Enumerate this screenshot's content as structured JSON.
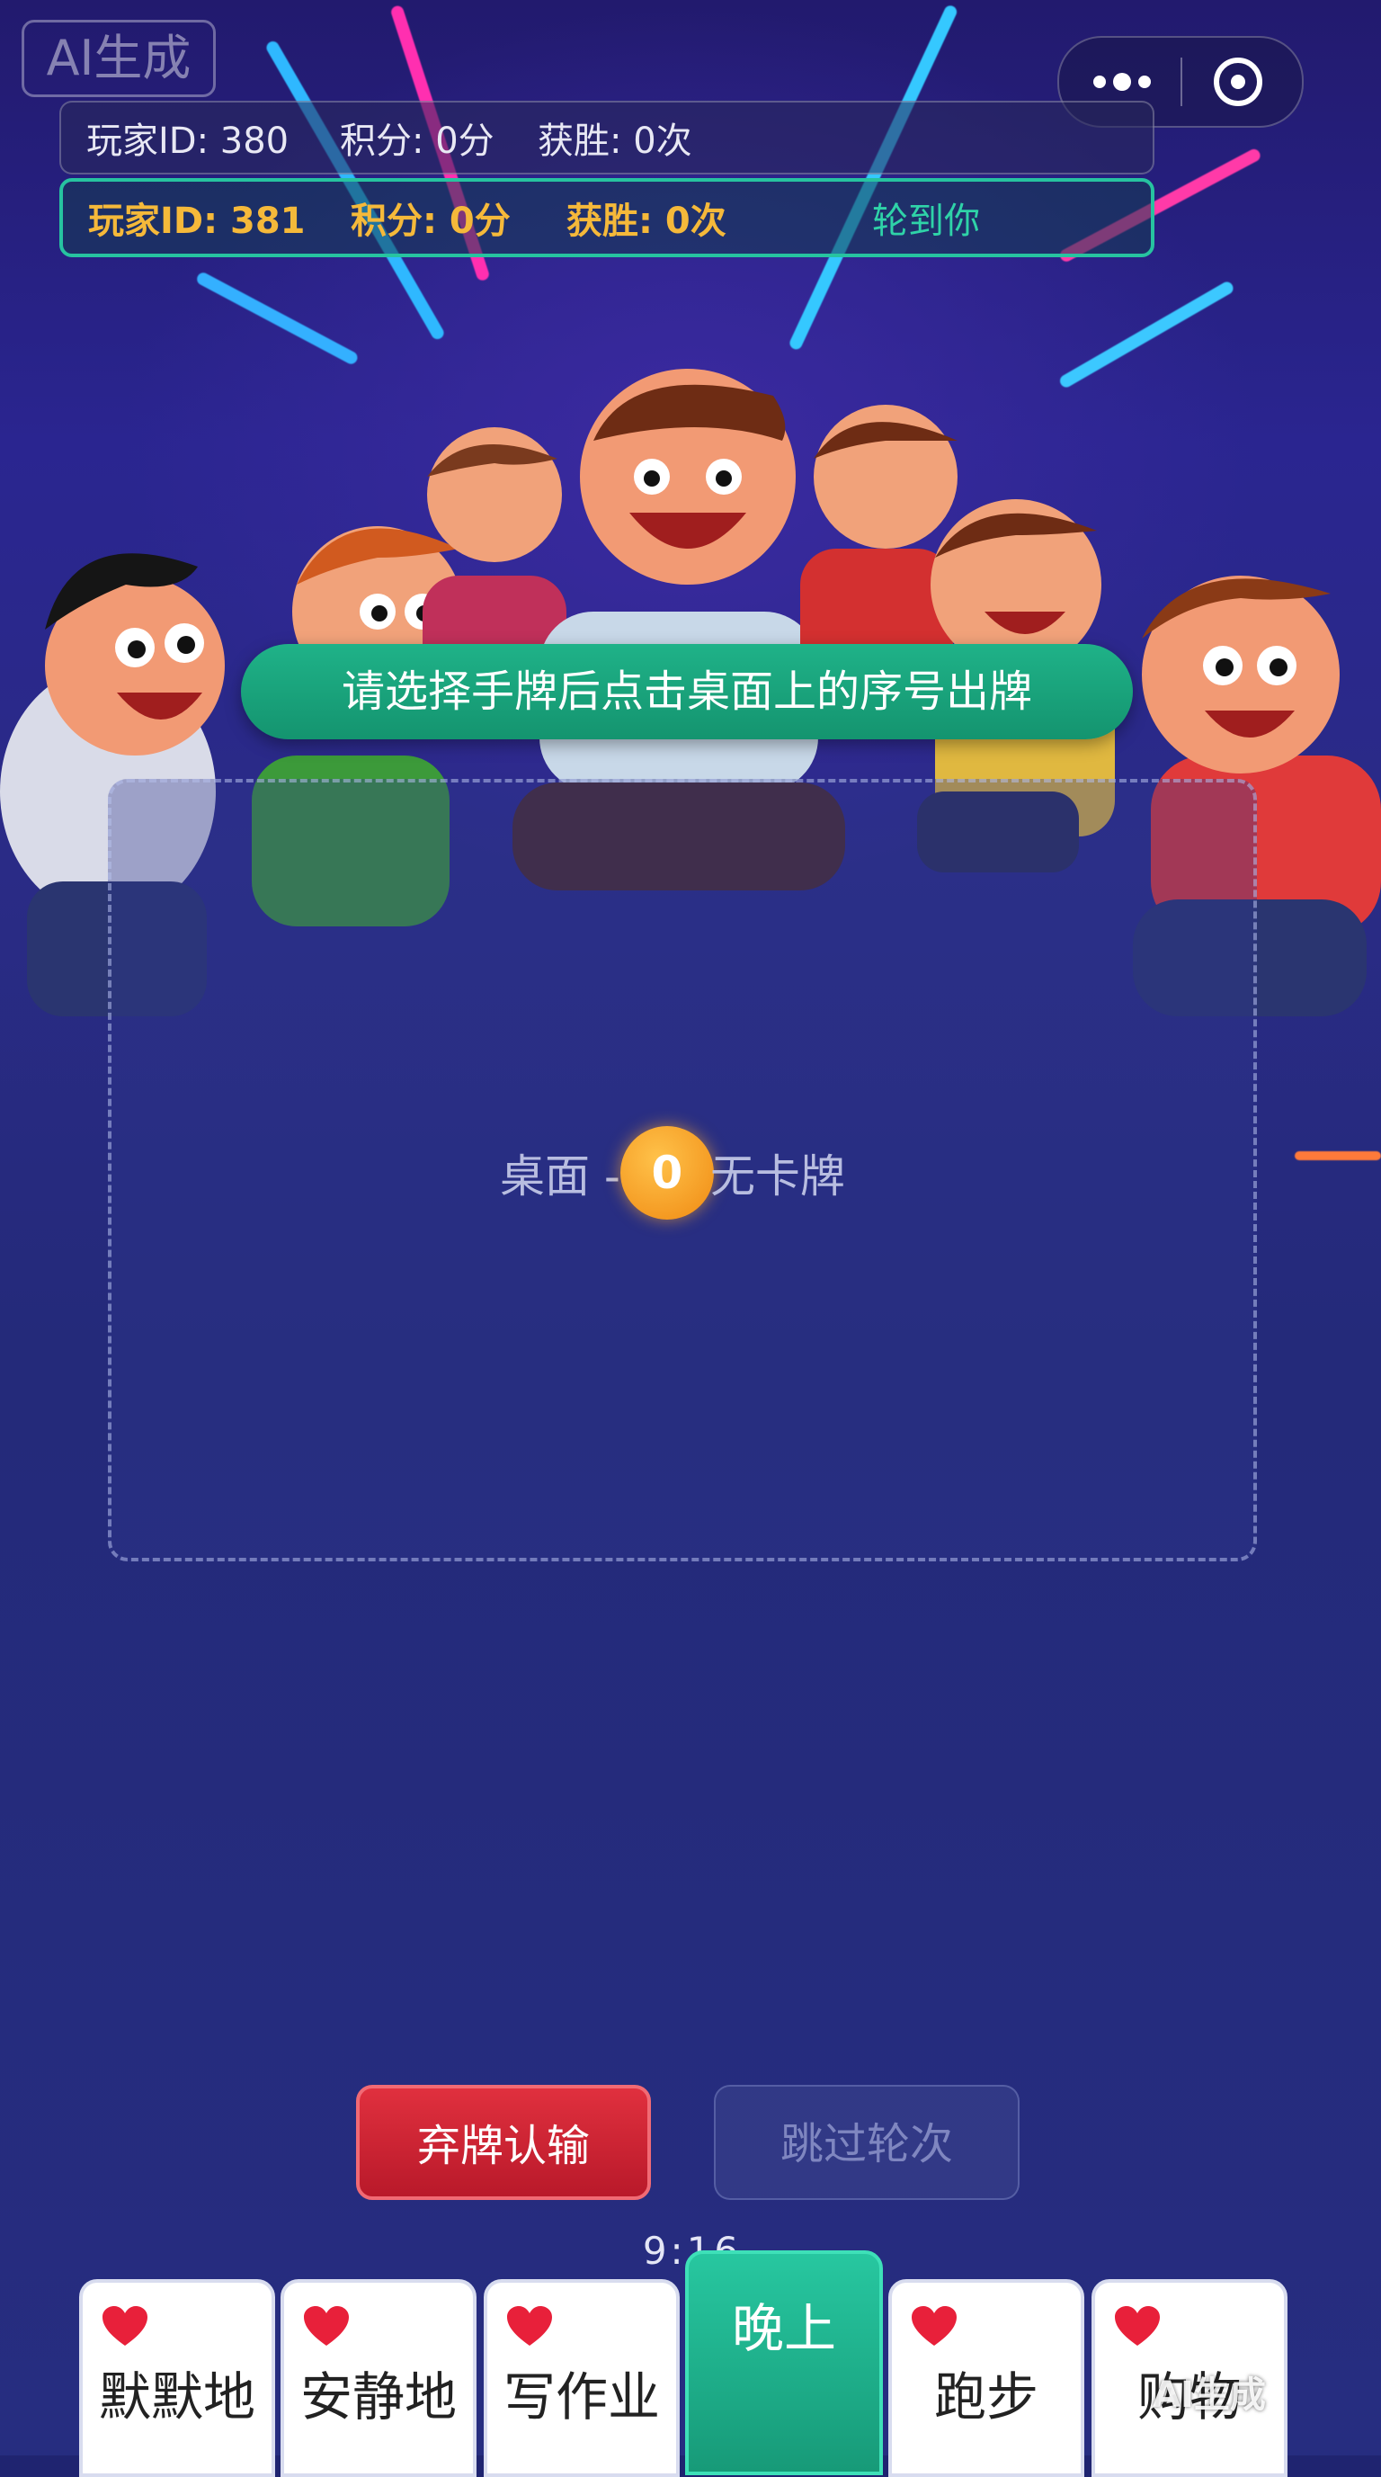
{
  "watermark": {
    "top_left": "AI生成",
    "bottom_right": "AI生成"
  },
  "players": {
    "other": {
      "id_text": "玩家ID: 380",
      "score_text": "积分: 0分",
      "wins_text": "获胜: 0次"
    },
    "me": {
      "id_text": "玩家ID: 381",
      "score_text": "积分: 0分",
      "wins_text": "获胜: 0次",
      "turn_text": "轮到你"
    }
  },
  "hint": "请选择手牌后点击桌面上的序号出牌",
  "table": {
    "prefix": "桌面 -",
    "number": "0",
    "suffix": "无卡牌"
  },
  "buttons": {
    "fold": "弃牌认输",
    "skip": "跳过轮次"
  },
  "timer": "9:16",
  "hand": [
    {
      "label": "默默地",
      "selected": false
    },
    {
      "label": "安静地",
      "selected": false
    },
    {
      "label": "写作业",
      "selected": false
    },
    {
      "label": "晚上",
      "selected": true
    },
    {
      "label": "跑步",
      "selected": false
    },
    {
      "label": "购物",
      "selected": false
    }
  ],
  "colors": {
    "accent": "#1fb288",
    "fold": "#d4202f",
    "coin": "#f5a623",
    "heart": "#e8203a"
  }
}
